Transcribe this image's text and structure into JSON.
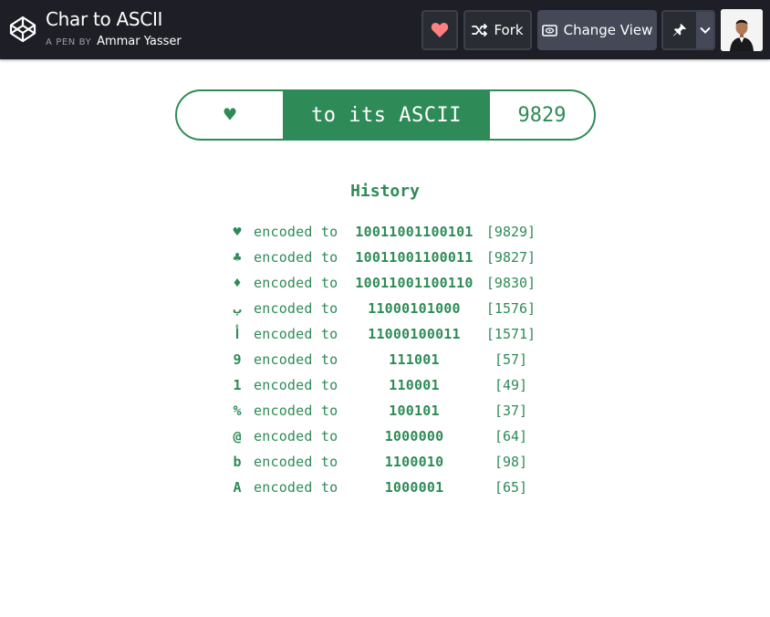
{
  "header": {
    "title": "Char to ASCII",
    "by_prefix": "A PEN BY",
    "author": "Ammar Yasser",
    "fork_label": "Fork",
    "change_view_label": "Change View",
    "heart_color": "#ff7a7a",
    "icons": [
      "codepen-logo-icon",
      "heart-icon",
      "fork-icon",
      "eye-icon",
      "pin-icon",
      "chevron-down-icon"
    ]
  },
  "converter": {
    "input_char": "♥",
    "label": "to its ASCII",
    "output_code": "9829",
    "accent": "#2e8b57"
  },
  "history": {
    "title": "History",
    "rows": [
      {
        "char": "♥",
        "word": "encoded to",
        "binary": "10011001100101",
        "code": "[9829]"
      },
      {
        "char": "♣",
        "word": "encoded to",
        "binary": "10011001100011",
        "code": "[9827]"
      },
      {
        "char": "♦",
        "word": "encoded to",
        "binary": "10011001100110",
        "code": "[9830]"
      },
      {
        "char": "ب",
        "word": "encoded to",
        "binary": "11000101000",
        "code": "[1576]"
      },
      {
        "char": "أ",
        "word": "encoded to",
        "binary": "11000100011",
        "code": "[1571]"
      },
      {
        "char": "9",
        "word": "encoded to",
        "binary": "111001",
        "code": "[57]"
      },
      {
        "char": "1",
        "word": "encoded to",
        "binary": "110001",
        "code": "[49]"
      },
      {
        "char": "%",
        "word": "encoded to",
        "binary": "100101",
        "code": "[37]"
      },
      {
        "char": "@",
        "word": "encoded to",
        "binary": "1000000",
        "code": "[64]"
      },
      {
        "char": "b",
        "word": "encoded to",
        "binary": "1100010",
        "code": "[98]"
      },
      {
        "char": "A",
        "word": "encoded to",
        "binary": "1000001",
        "code": "[65]"
      }
    ]
  }
}
